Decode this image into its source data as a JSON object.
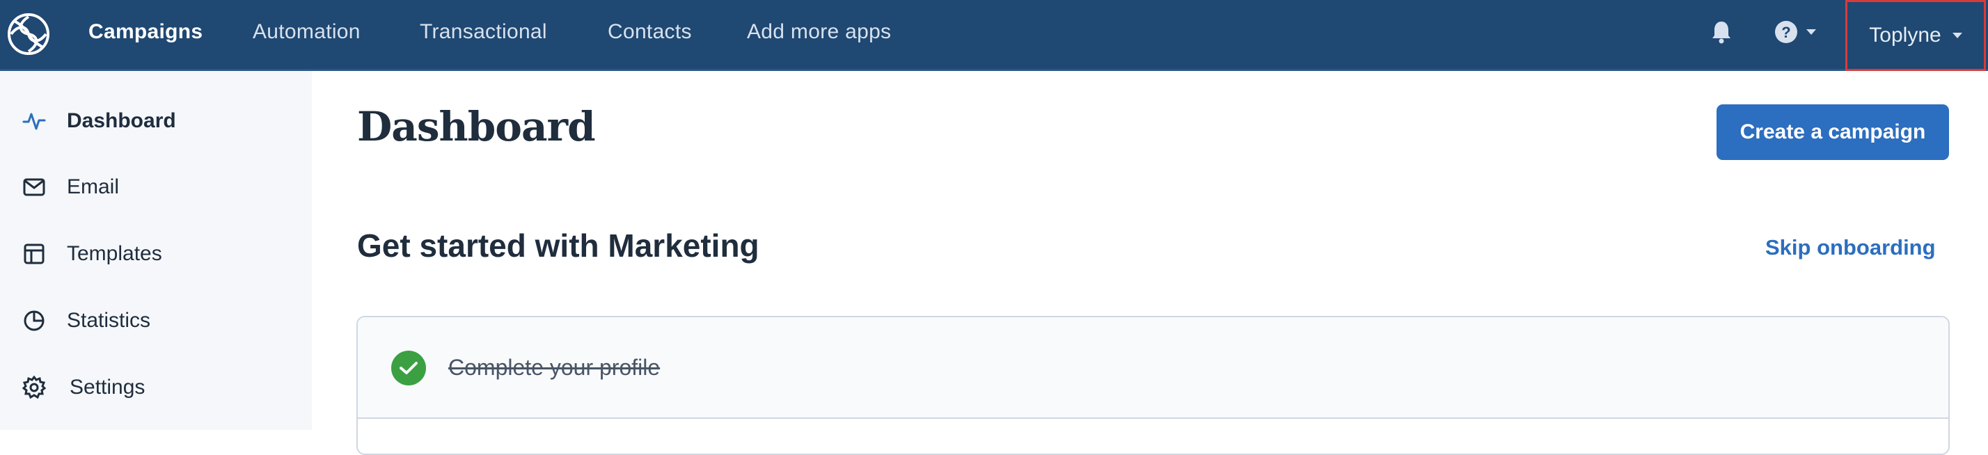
{
  "topbar": {
    "nav": [
      {
        "label": "Campaigns",
        "active": true
      },
      {
        "label": "Automation",
        "active": false
      },
      {
        "label": "Transactional",
        "active": false
      },
      {
        "label": "Contacts",
        "active": false
      },
      {
        "label": "Add more apps",
        "active": false
      }
    ],
    "icons": {
      "logo": "sendinblue-logo-icon",
      "bell": "bell-icon",
      "help": "help-circle-icon"
    },
    "account_label": "Toplyne"
  },
  "sidebar": {
    "items": [
      {
        "label": "Dashboard",
        "icon": "activity-icon",
        "active": true
      },
      {
        "label": "Email",
        "icon": "mail-icon",
        "active": false
      },
      {
        "label": "Templates",
        "icon": "template-icon",
        "active": false
      },
      {
        "label": "Statistics",
        "icon": "pie-chart-icon",
        "active": false
      },
      {
        "label": "Settings",
        "icon": "gear-icon",
        "active": false
      }
    ]
  },
  "main": {
    "title": "Dashboard",
    "create_button": "Create a campaign",
    "section_title": "Get started with Marketing",
    "skip_link": "Skip onboarding",
    "steps": [
      {
        "label": "Complete your profile",
        "completed": true
      }
    ]
  },
  "colors": {
    "topbar": "#1f4872",
    "accent": "#2c6ebf",
    "success": "#3ba042",
    "highlight": "#d83b3b"
  }
}
